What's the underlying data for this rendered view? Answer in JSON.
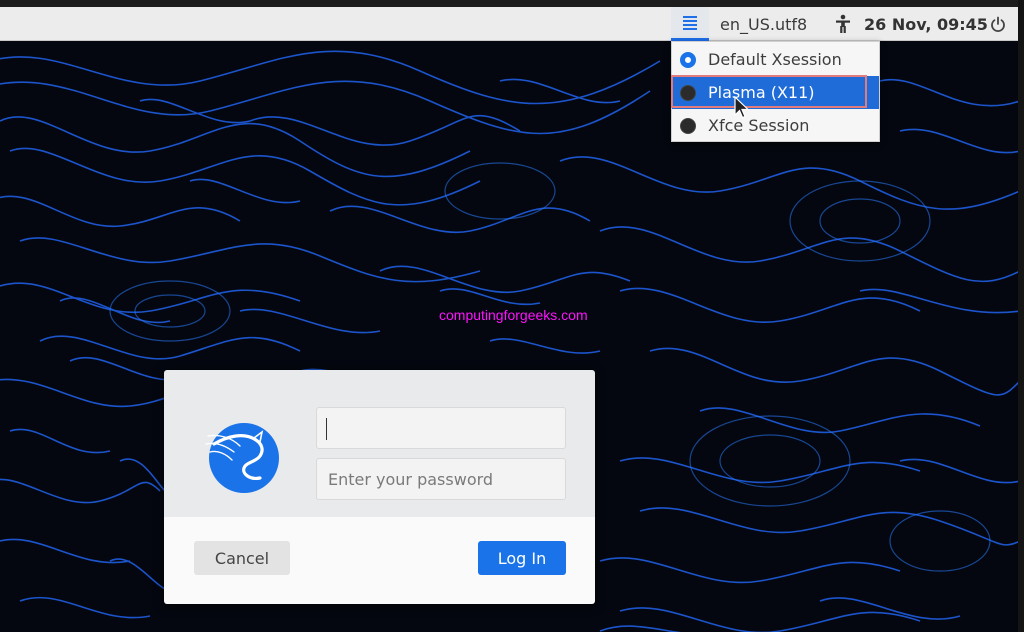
{
  "top_panel": {
    "session_icon": "session-menu-icon",
    "language": "en_US.utf8",
    "accessibility_icon": "accessibility-icon",
    "clock": "26 Nov, 09:45",
    "power_icon": "power-icon"
  },
  "session_menu": {
    "items": [
      {
        "label": "Default Xsession",
        "state": "checked"
      },
      {
        "label": "Plasma (X11)",
        "state": "unchecked"
      },
      {
        "label": "Xfce Session",
        "state": "unchecked"
      }
    ]
  },
  "watermark": "computingforgeeks.com",
  "login": {
    "logo_icon": "kali-dragon-logo",
    "username_value": "",
    "password_placeholder": "Enter your password",
    "cancel_label": "Cancel",
    "login_label": "Log In"
  },
  "colors": {
    "accent": "#1a73e8",
    "menu_highlight": "#1f6bd8",
    "annotation_box": "#e27c7c",
    "watermark": "#ff13ff",
    "contour_lines": "#1f5de0"
  }
}
